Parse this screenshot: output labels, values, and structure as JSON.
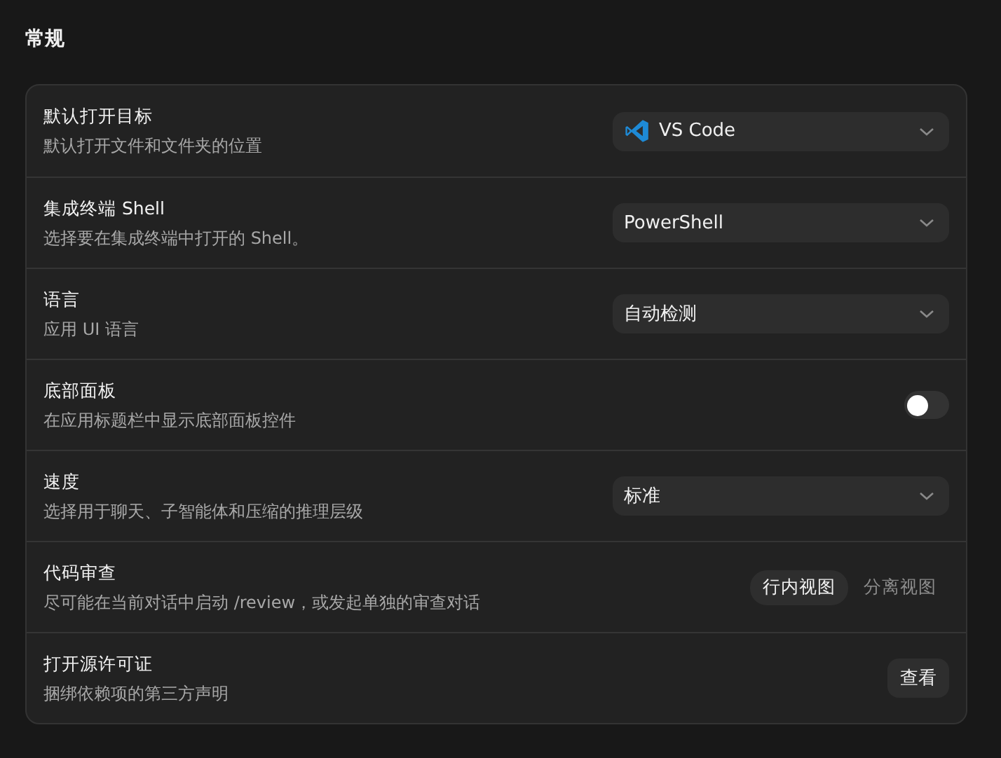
{
  "section_title": "常规",
  "settings": [
    {
      "kind": "select",
      "title": "默认打开目标",
      "description": "默认打开文件和文件夹的位置",
      "value": "VS Code",
      "icon": true
    },
    {
      "kind": "select",
      "title": "集成终端 Shell",
      "description": "选择要在集成终端中打开的 Shell。",
      "value": "PowerShell",
      "icon": false
    },
    {
      "kind": "select",
      "title": "语言",
      "description": "应用 UI 语言",
      "value": "自动检测",
      "icon": false
    },
    {
      "kind": "toggle",
      "title": "底部面板",
      "description": "在应用标题栏中显示底部面板控件",
      "on": false
    },
    {
      "kind": "select",
      "title": "速度",
      "description": "选择用于聊天、子智能体和压缩的推理层级",
      "value": "标准",
      "icon": false
    },
    {
      "kind": "segmented",
      "title": "代码审查",
      "description": "尽可能在当前对话中启动 /review，或发起单独的审查对话",
      "options": [
        {
          "label": "行内视图",
          "selected": true
        },
        {
          "label": "分离视图",
          "selected": false
        }
      ]
    },
    {
      "kind": "button",
      "title": "打开源许可证",
      "description": "捆绑依赖项的第三方声明",
      "button": "查看"
    }
  ]
}
